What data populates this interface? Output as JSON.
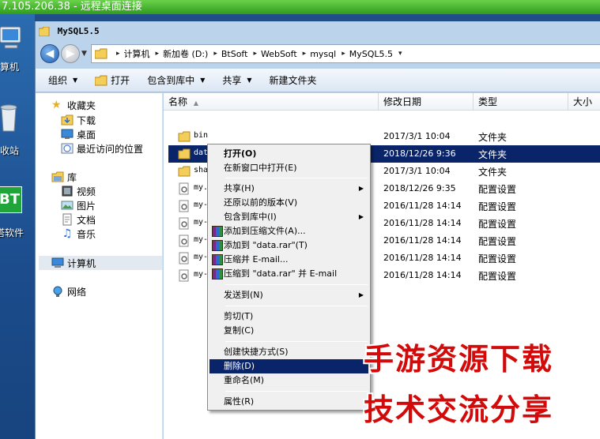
{
  "rdp": {
    "title": "7.105.206.38 - 远程桌面连接"
  },
  "desktop": {
    "icons": [
      {
        "label": "算机"
      },
      {
        "label": "收站"
      },
      {
        "label": "BT",
        "caption": "塔软件"
      }
    ]
  },
  "window": {
    "title": "MySQL5.5"
  },
  "address": {
    "crumbs": [
      "计算机",
      "新加卷 (D:)",
      "BtSoft",
      "WebSoft",
      "mysql",
      "MySQL5.5"
    ]
  },
  "toolbar": {
    "organize": "组织",
    "open": "打开",
    "include": "包含到库中",
    "share": "共享",
    "new_folder": "新建文件夹"
  },
  "nav": {
    "favorites": "收藏夹",
    "downloads": "下载",
    "desktop": "桌面",
    "recent": "最近访问的位置",
    "libraries": "库",
    "videos": "视频",
    "pictures": "图片",
    "documents": "文档",
    "music": "音乐",
    "computer": "计算机",
    "network": "网络"
  },
  "columns": {
    "name": "名称",
    "date": "修改日期",
    "type": "类型",
    "size": "大小"
  },
  "files": [
    {
      "name": "bin",
      "date": "2017/3/1 10:04",
      "type": "文件夹",
      "kind": "folder"
    },
    {
      "name": "data",
      "date": "2018/12/26 9:36",
      "type": "文件夹",
      "kind": "folder",
      "selected": true
    },
    {
      "name": "sha",
      "date": "2017/3/1 10:04",
      "type": "文件夹",
      "kind": "folder"
    },
    {
      "name": "my.",
      "date": "2018/12/26 9:35",
      "type": "配置设置",
      "kind": "config"
    },
    {
      "name": "my-",
      "date": "2016/11/28 14:14",
      "type": "配置设置",
      "kind": "config"
    },
    {
      "name": "my-",
      "date": "2016/11/28 14:14",
      "type": "配置设置",
      "kind": "config"
    },
    {
      "name": "my-",
      "date": "2016/11/28 14:14",
      "type": "配置设置",
      "kind": "config"
    },
    {
      "name": "my-",
      "date": "2016/11/28 14:14",
      "type": "配置设置",
      "kind": "config"
    },
    {
      "name": "my-",
      "date": "2016/11/28 14:14",
      "type": "配置设置",
      "kind": "config"
    }
  ],
  "context_menu": {
    "open": "打开(O)",
    "open_new_window": "在新窗口中打开(E)",
    "share": "共享(H)",
    "restore": "还原以前的版本(V)",
    "include_library": "包含到库中(I)",
    "add_archive": "添加到压缩文件(A)...",
    "add_rar": "添加到 \"data.rar\"(T)",
    "compress_email": "压缩并 E-mail...",
    "compress_rar_email": "压缩到 \"data.rar\" 并 E-mail",
    "send_to": "发送到(N)",
    "cut": "剪切(T)",
    "copy": "复制(C)",
    "create_shortcut": "创建快捷方式(S)",
    "delete": "删除(D)",
    "rename": "重命名(M)",
    "properties": "属性(R)"
  },
  "watermark": {
    "line1": "手游资源下载",
    "line2": "技术交流分享"
  },
  "colors": {
    "selection": "#0a246a",
    "watermark": "#d20a0a",
    "rdp_bar": "#2f9a1e"
  }
}
